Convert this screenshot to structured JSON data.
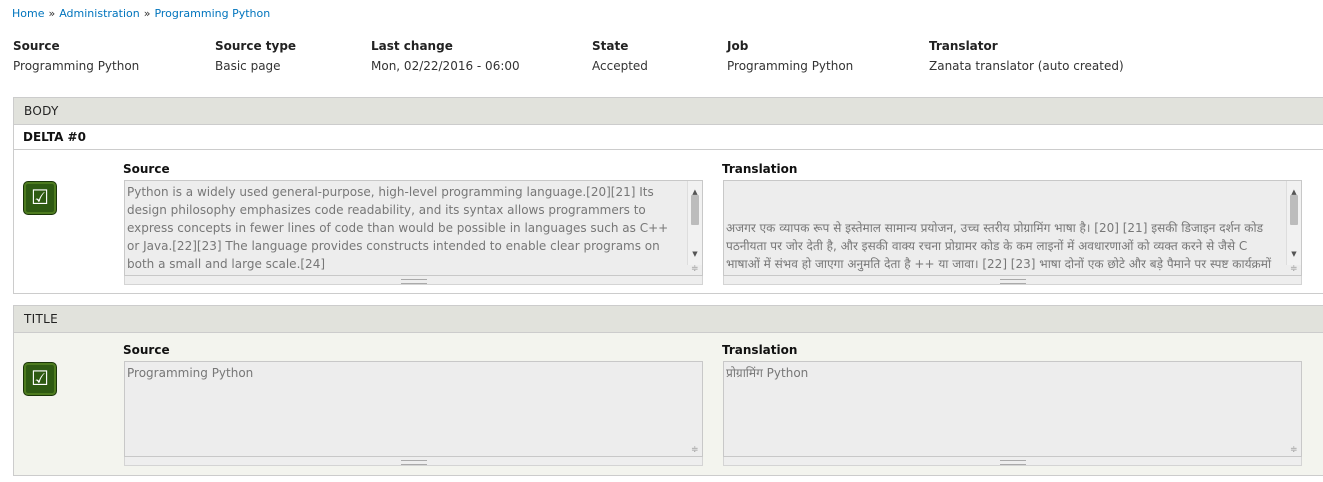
{
  "breadcrumb": [
    {
      "label": "Home"
    },
    {
      "label": "Administration"
    },
    {
      "label": "Programming Python"
    }
  ],
  "breadcrumb_separator": "»",
  "meta": {
    "source_label": "Source",
    "source_value": "Programming Python",
    "source_type_label": "Source type",
    "source_type_value": "Basic page",
    "last_change_label": "Last change",
    "last_change_value": "Mon, 02/22/2016 - 06:00",
    "state_label": "State",
    "state_value": "Accepted",
    "job_label": "Job",
    "job_value": "Programming Python",
    "translator_label": "Translator",
    "translator_value": "Zanata translator (auto created)"
  },
  "body_section": {
    "header": "BODY",
    "delta": "DELTA #0",
    "status_icon": "checkmark-icon",
    "source_label": "Source",
    "source_text": "Python is a widely used general-purpose, high-level programming language.[20][21] Its design philosophy emphasizes code readability, and its syntax allows programmers to express concepts in fewer lines of code than would be possible in languages such as C++ or Java.[22][23] The language provides constructs intended to enable clear programs on both a small and large scale.[24]",
    "translation_label": "Translation",
    "translation_text": "अजगर एक व्यापक रूप से इस्तेमाल सामान्य प्रयोजन, उच्च स्तरीय प्रोग्रामिंग भाषा है। [20] [21] इसकी डिजाइन दर्शन कोड पठनीयता पर जोर देती है, और इसकी वाक्य रचना प्रोग्रामर कोड के कम लाइनों में अवधारणाओं को व्यक्त करने से जैसे C भाषाओं में संभव हो जाएगा अनुमति देता है ++ या जावा। [22] [23] भाषा दोनों एक छोटे और बड़े पैमाने पर स्पष्ट कार्यक्रमों को सक्षम करने का इरादा निर्माणों प्रदान करता है। [24]\nअजगर वस्तु उन्मुख, जरूरी और कार्यात्मक प्रोग्रामिंग या प्रक्रियात्मक शैलियों सहित कई प्रोग्रामिंग मानदंड, समर्थन करता है। यह एक"
  },
  "title_section": {
    "header": "TITLE",
    "status_icon": "checkmark-icon",
    "source_label": "Source",
    "source_text": "Programming Python",
    "translation_label": "Translation",
    "translation_text": "प्रोग्रामिंग Python"
  },
  "colors": {
    "link": "#0074bd",
    "header_bg": "#e1e2dc",
    "status_green": "#2e5a12"
  }
}
